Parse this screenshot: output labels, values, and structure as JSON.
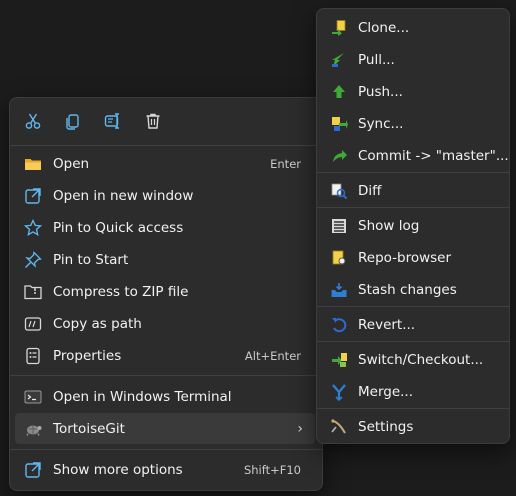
{
  "toolbar": {
    "icons": [
      "cut-icon",
      "copy-icon",
      "rename-icon",
      "delete-icon"
    ],
    "accent": "#60b8f0"
  },
  "context_menu": {
    "items": [
      {
        "label": "Open",
        "shortcut": "Enter",
        "icon": "folder-open-icon"
      },
      {
        "label": "Open in new window",
        "icon": "open-new-window-icon"
      },
      {
        "label": "Pin to Quick access",
        "icon": "star-icon"
      },
      {
        "label": "Pin to Start",
        "icon": "pin-icon"
      },
      {
        "label": "Compress to ZIP file",
        "icon": "zip-folder-icon"
      },
      {
        "label": "Copy as path",
        "icon": "copy-path-icon"
      },
      {
        "label": "Properties",
        "shortcut": "Alt+Enter",
        "icon": "properties-icon"
      },
      {
        "label": "Open in Windows Terminal",
        "icon": "terminal-icon"
      },
      {
        "label": "TortoiseGit",
        "icon": "tortoisegit-icon",
        "submenu_arrow": "›"
      },
      {
        "label": "Show more options",
        "shortcut": "Shift+F10",
        "icon": "more-options-icon"
      }
    ]
  },
  "submenu": {
    "items": [
      {
        "label": "Clone...",
        "icon": "clone-icon"
      },
      {
        "label": "Pull...",
        "icon": "pull-icon"
      },
      {
        "label": "Push...",
        "icon": "push-icon"
      },
      {
        "label": "Sync...",
        "icon": "sync-icon"
      },
      {
        "label": "Commit -> \"master\"...",
        "icon": "commit-icon"
      },
      {
        "label": "Diff",
        "icon": "diff-icon"
      },
      {
        "label": "Show log",
        "icon": "show-log-icon"
      },
      {
        "label": "Repo-browser",
        "icon": "repo-browser-icon"
      },
      {
        "label": "Stash changes",
        "icon": "stash-icon"
      },
      {
        "label": "Revert...",
        "icon": "revert-icon"
      },
      {
        "label": "Switch/Checkout...",
        "icon": "switch-checkout-icon"
      },
      {
        "label": "Merge...",
        "icon": "merge-icon"
      },
      {
        "label": "Settings",
        "icon": "settings-icon"
      }
    ]
  }
}
